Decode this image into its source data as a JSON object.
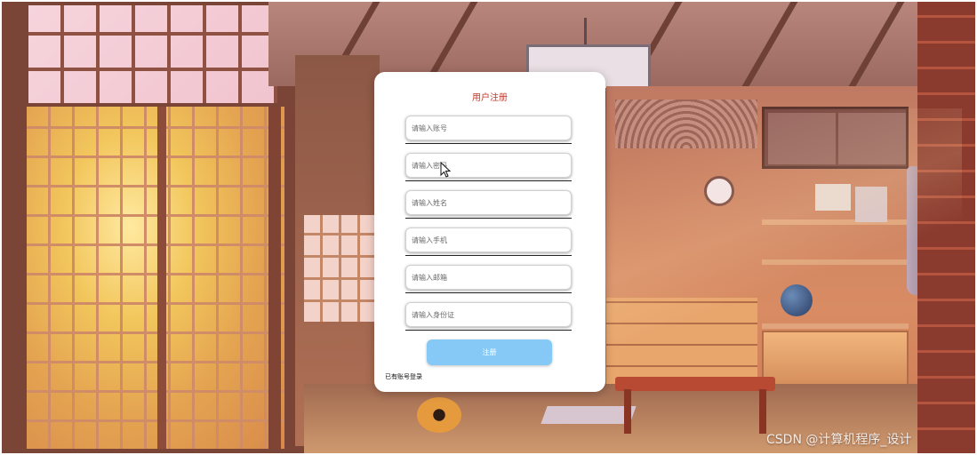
{
  "form": {
    "title": "用户注册",
    "fields": [
      {
        "name": "account",
        "placeholder": "请输入账号"
      },
      {
        "name": "password",
        "placeholder": "请输入密码"
      },
      {
        "name": "name",
        "placeholder": "请输入姓名"
      },
      {
        "name": "phone",
        "placeholder": "请输入手机"
      },
      {
        "name": "email",
        "placeholder": "请输入邮箱"
      },
      {
        "name": "id_card",
        "placeholder": "请输入身份证"
      }
    ],
    "submit_label": "注册",
    "login_link_label": "已有账号登录"
  },
  "watermark": "CSDN @计算机程序_设计",
  "colors": {
    "title": "#c0392b",
    "submit_button": "#87c9f6",
    "card_background": "#ffffff"
  },
  "icons": {
    "cursor": "mouse-pointer-icon"
  }
}
